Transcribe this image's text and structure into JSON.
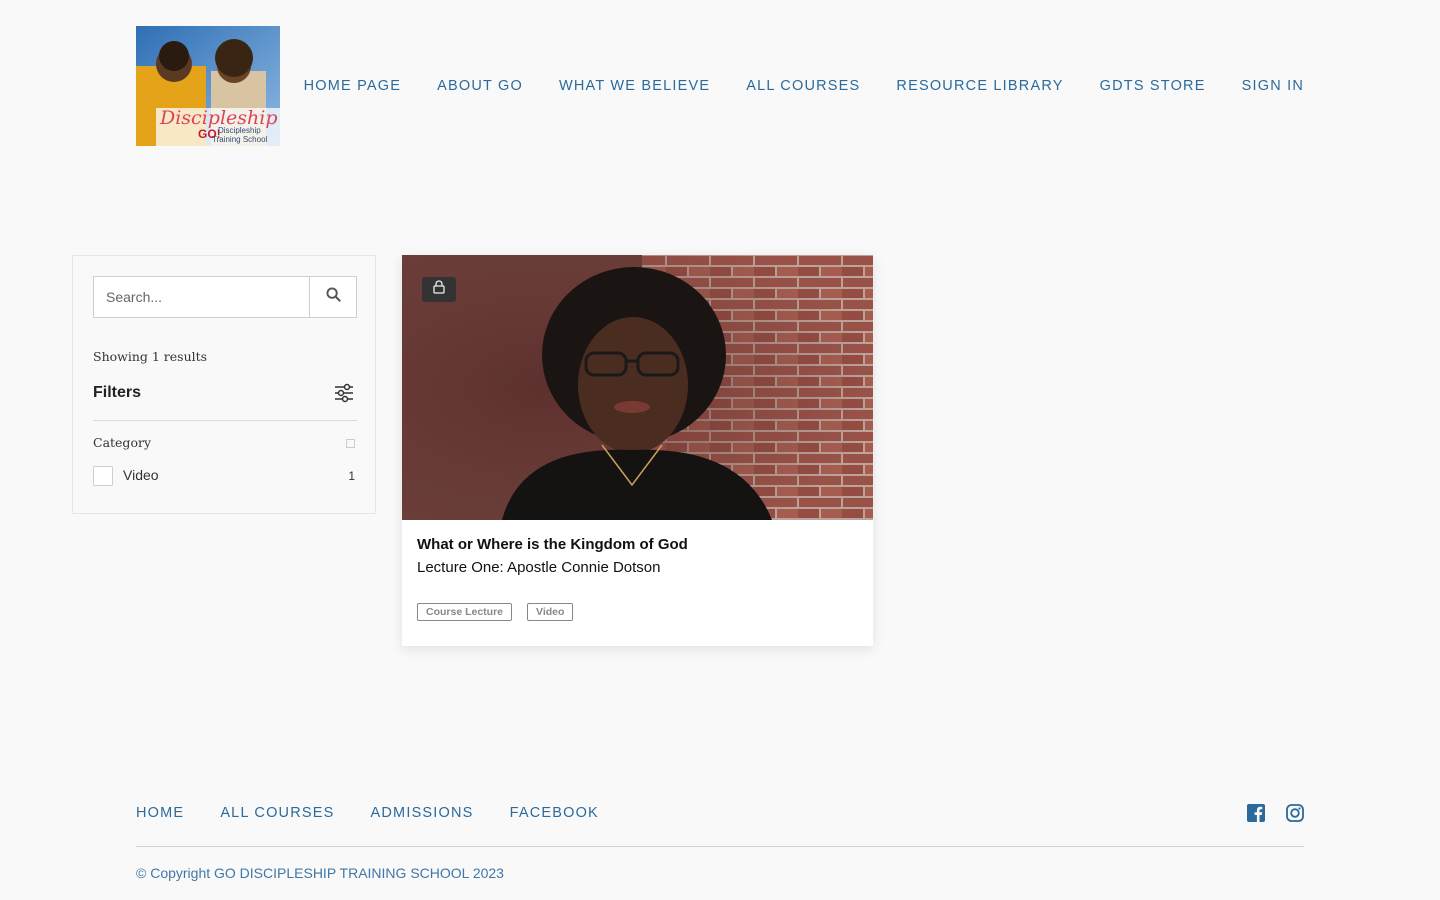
{
  "header": {
    "logo": {
      "text_main": "Discipleship",
      "text_go": "GO!",
      "text_sub1": "Discipleship",
      "text_sub2": "Training School"
    },
    "nav": [
      {
        "label": "HOME PAGE"
      },
      {
        "label": "ABOUT GO"
      },
      {
        "label": "WHAT WE BELIEVE"
      },
      {
        "label": "ALL COURSES"
      },
      {
        "label": "RESOURCE LIBRARY"
      },
      {
        "label": "GDTS STORE"
      },
      {
        "label": "SIGN IN"
      }
    ]
  },
  "sidebar": {
    "search_placeholder": "Search...",
    "search_icon": "search-icon",
    "results_text": "Showing 1 results",
    "filters_title": "Filters",
    "filters_icon": "sliders-icon",
    "category_label": "Category",
    "options": [
      {
        "label": "Video",
        "count": "1",
        "checked": false
      }
    ]
  },
  "card": {
    "locked": true,
    "lock_icon": "lock-icon",
    "title": "What or Where is the Kingdom of God",
    "subtitle": "Lecture One: Apostle Connie Dotson",
    "tags": [
      "Course Lecture",
      "Video"
    ]
  },
  "footer": {
    "nav": [
      {
        "label": "HOME"
      },
      {
        "label": "ALL COURSES"
      },
      {
        "label": "ADMISSIONS"
      },
      {
        "label": "FACEBOOK"
      }
    ],
    "social": [
      "facebook-icon",
      "instagram-icon"
    ],
    "copyright": "© Copyright GO DISCIPLESHIP TRAINING SCHOOL 2023"
  },
  "colors": {
    "nav_link": "#2b6a9b",
    "page_bg": "#f9f9f9"
  }
}
